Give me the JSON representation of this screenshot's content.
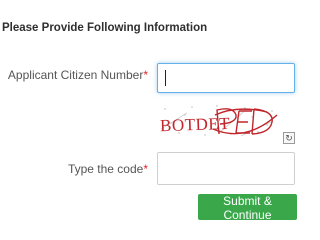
{
  "form": {
    "heading": "Please Provide Following Information",
    "citizen_field": {
      "label": "Applicant Citizen Number",
      "required_mark": "*",
      "value": ""
    },
    "captcha": {
      "text": "BOTDET"
    },
    "code_field": {
      "label": "Type the code",
      "required_mark": "*",
      "value": ""
    },
    "submit_label": "Submit & Continue"
  },
  "colors": {
    "accent": "#3aa84a",
    "required": "#e0262b",
    "focus_border": "#66afe9",
    "captcha_ink": "#c0262b"
  },
  "icons": {
    "refresh": "refresh-icon"
  }
}
